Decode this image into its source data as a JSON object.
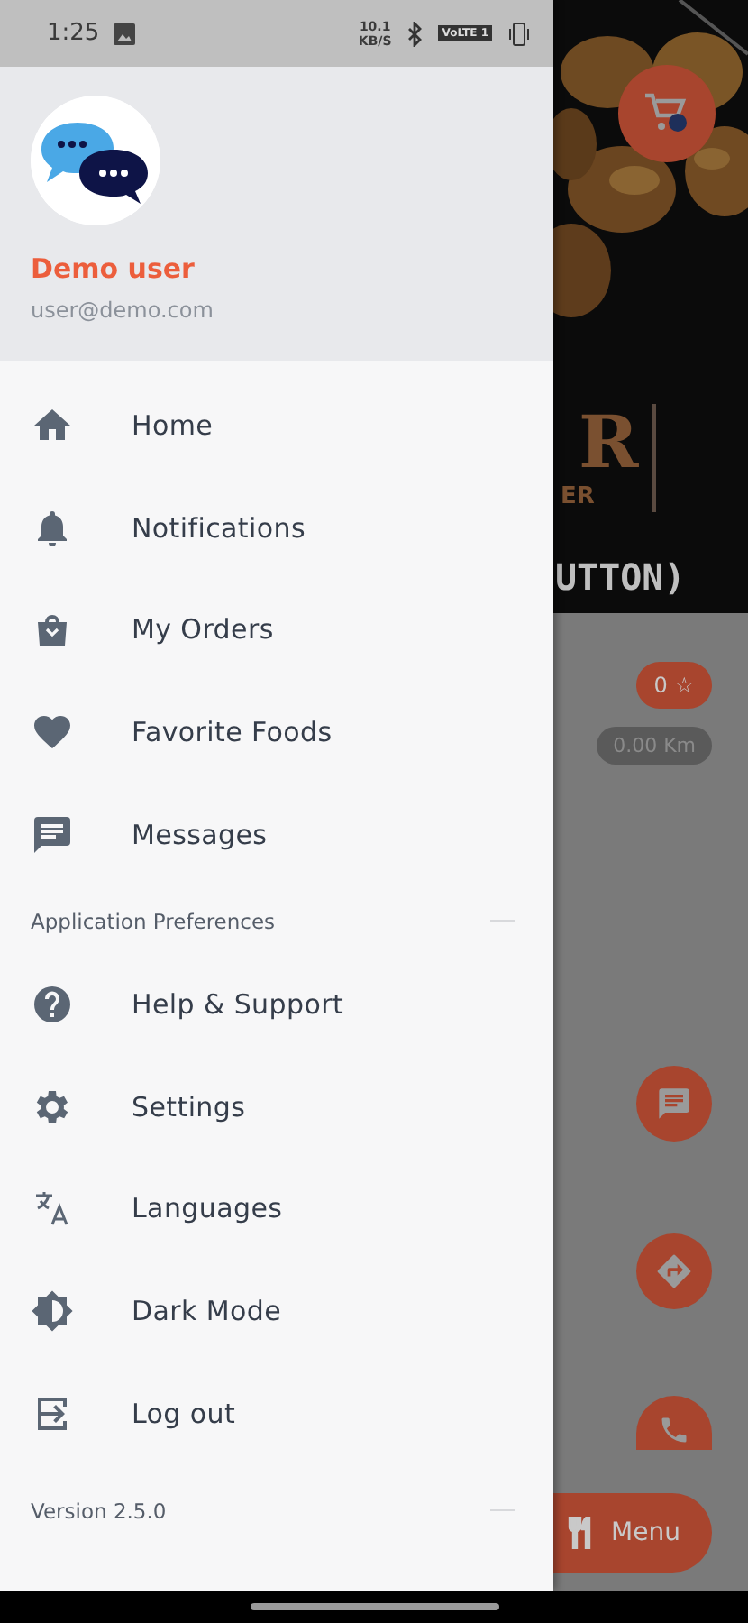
{
  "status_bar": {
    "time": "1:25",
    "speed": "10.1",
    "speed_unit": "KB/S",
    "network": "VoLTE 1"
  },
  "drawer": {
    "user": {
      "name": "Demo user",
      "email": "user@demo.com"
    },
    "items": [
      {
        "label": "Home"
      },
      {
        "label": "Notifications"
      },
      {
        "label": "My Orders"
      },
      {
        "label": "Favorite Foods"
      },
      {
        "label": "Messages"
      }
    ],
    "section": {
      "title": "Application Preferences"
    },
    "preference_items": [
      {
        "label": "Help & Support"
      },
      {
        "label": "Settings"
      },
      {
        "label": "Languages"
      },
      {
        "label": "Dark Mode"
      },
      {
        "label": "Log out"
      }
    ],
    "version": "Version 2.5.0"
  },
  "background": {
    "logo_letter": "R",
    "logo_suffix": "ER",
    "heading": "UTTON)",
    "rating": "0 ☆",
    "distance": "0.00 Km",
    "menu_button": "Menu"
  }
}
